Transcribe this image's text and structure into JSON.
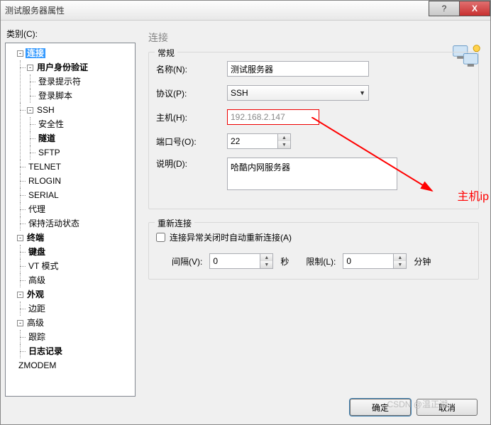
{
  "window": {
    "title": "测试服务器属性"
  },
  "category_label": "类别(C):",
  "tree": {
    "root": "连接",
    "auth": "用户身份验证",
    "login_prompt": "登录提示符",
    "login_script": "登录脚本",
    "ssh": "SSH",
    "security": "安全性",
    "tunnel": "隧道",
    "sftp": "SFTP",
    "telnet": "TELNET",
    "rlogin": "RLOGIN",
    "serial": "SERIAL",
    "proxy": "代理",
    "keepalive": "保持活动状态",
    "terminal": "终端",
    "keyboard": "键盘",
    "vtmode": "VT 模式",
    "advanced_term": "高级",
    "appearance": "外观",
    "margin": "边距",
    "advanced": "高级",
    "trace": "跟踪",
    "logging": "日志记录",
    "zmodem": "ZMODEM"
  },
  "panel": {
    "title": "连接",
    "general_legend": "常规",
    "name_label": "名称(N):",
    "name_value": "测试服务器",
    "protocol_label": "协议(P):",
    "protocol_value": "SSH",
    "host_label": "主机(H):",
    "host_value": "192.168.2.147",
    "port_label": "端口号(O):",
    "port_value": "22",
    "desc_label": "说明(D):",
    "desc_value": "哈酷内网服务器",
    "reconnect_legend": "重新连接",
    "reconnect_checkbox": "连接异常关闭时自动重新连接(A)",
    "interval_label": "间隔(V):",
    "interval_value": "0",
    "interval_unit": "秒",
    "limit_label": "限制(L):",
    "limit_value": "0",
    "limit_unit": "分钟"
  },
  "buttons": {
    "ok": "确定",
    "cancel": "取消"
  },
  "annotation": {
    "host_ip": "主机ip"
  },
  "watermark": "CSDN @温正湖"
}
